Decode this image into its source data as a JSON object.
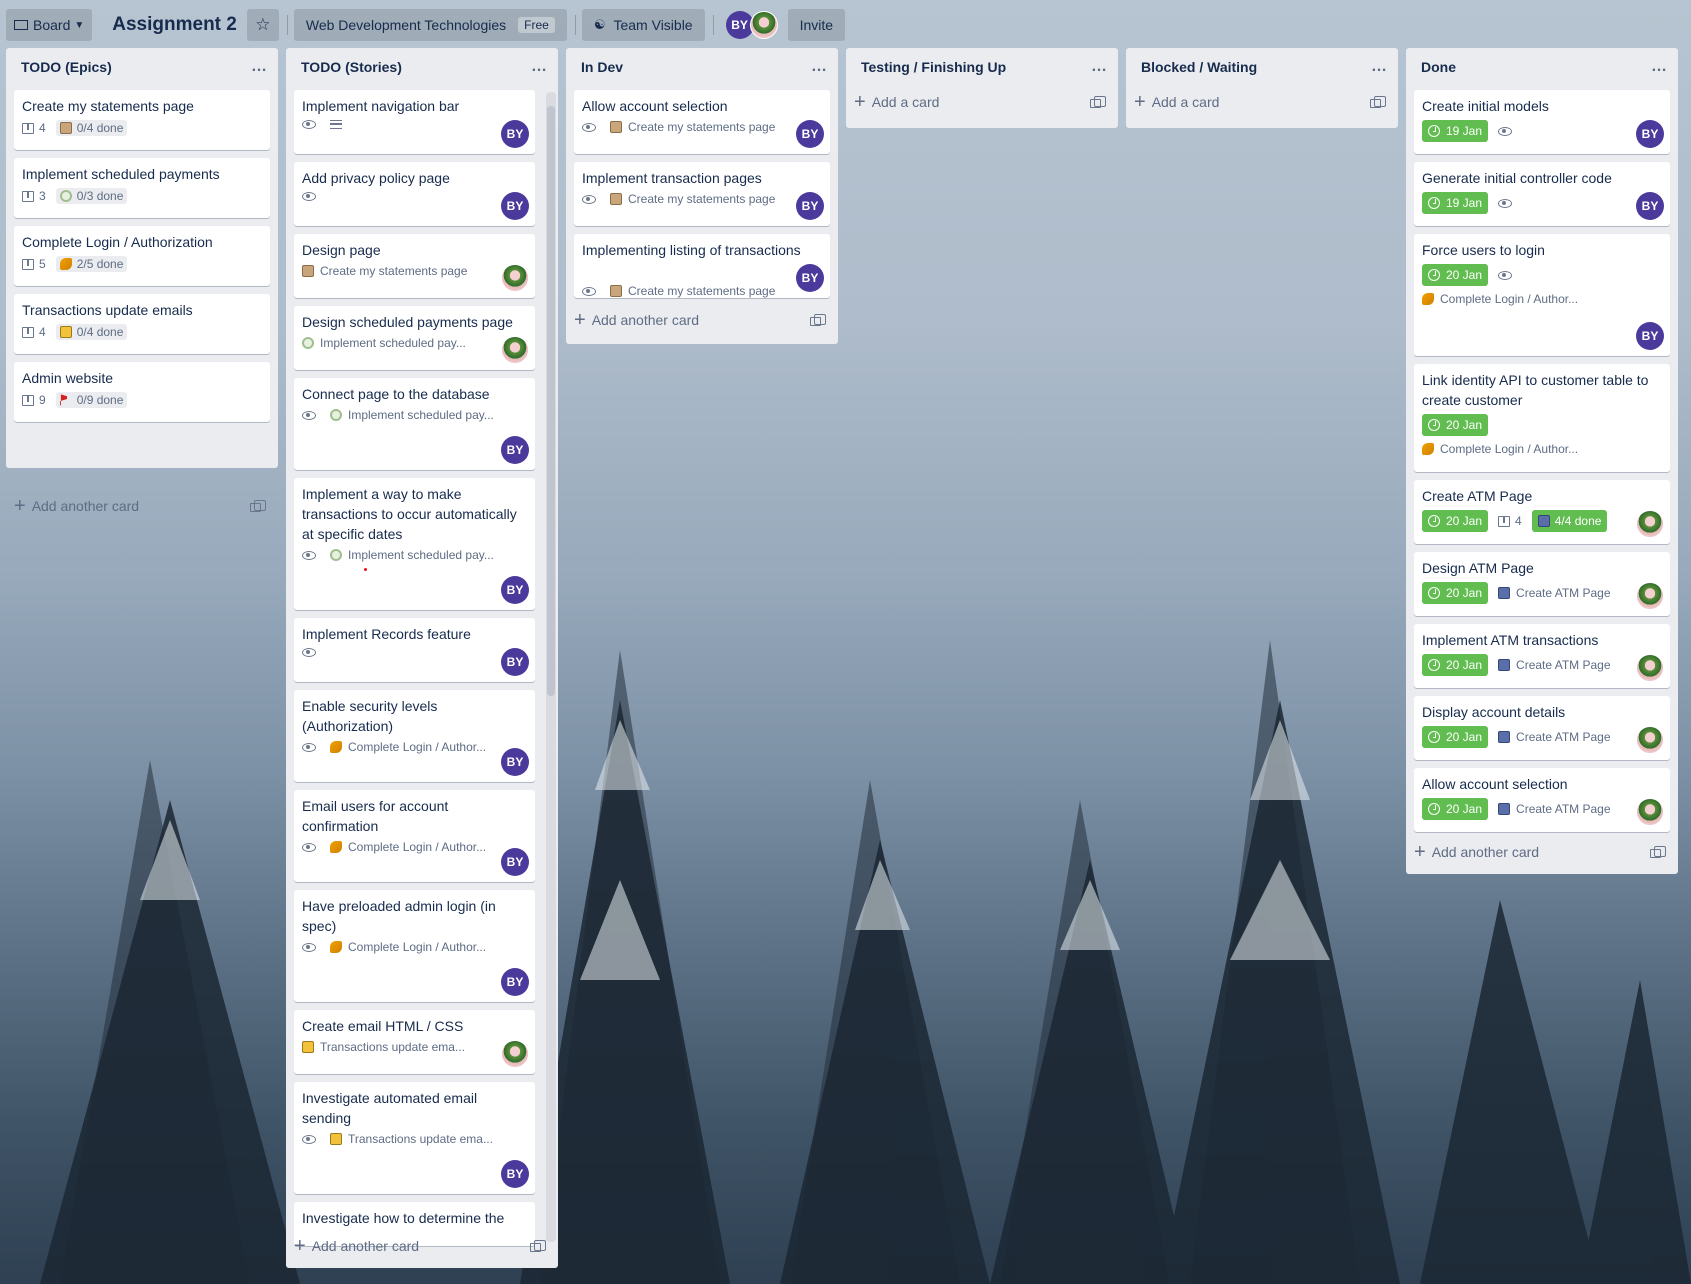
{
  "header": {
    "board_btn": "Board",
    "title": "Assignment 2",
    "team": "Web Development Technologies",
    "team_plan": "Free",
    "visibility": "Team Visible",
    "member_initials": "BY",
    "invite": "Invite"
  },
  "icons": {
    "board": "board-icon",
    "star": "star-icon",
    "eye": "eye-icon",
    "description": "description-icon",
    "due": "clock-icon",
    "more": "more-icon",
    "plus": "plus-icon",
    "template": "template-icon"
  },
  "colors": {
    "due_complete": "#61bd4f",
    "avatar": "#4b3a9c",
    "list_bg": "#ebecf0"
  },
  "lists": [
    {
      "title": "TODO (Epics)",
      "add": "Add another card",
      "cards": [
        {
          "title": "Create my statements page",
          "count": "4",
          "checklist": "0/4 done"
        },
        {
          "title": "Implement scheduled payments",
          "count": "3",
          "checklist": "0/3 done"
        },
        {
          "title": "Complete Login / Authorization",
          "count": "5",
          "checklist": "2/5 done"
        },
        {
          "title": "Transactions update emails",
          "count": "4",
          "checklist": "0/4 done"
        },
        {
          "title": "Admin website",
          "count": "9",
          "checklist": "0/9 done"
        }
      ]
    },
    {
      "title": "TODO (Stories)",
      "add": "Add another card",
      "cards": [
        {
          "title": "Implement navigation bar"
        },
        {
          "title": "Add privacy policy page"
        },
        {
          "title": "Design page",
          "epic": "Create my statements page"
        },
        {
          "title": "Design scheduled payments page",
          "epic": "Implement scheduled pay..."
        },
        {
          "title": "Connect page to the database",
          "epic": "Implement scheduled pay..."
        },
        {
          "title": "Implement a way to make transactions to occur automatically at specific dates",
          "epic": "Implement scheduled pay..."
        },
        {
          "title": "Implement Records feature"
        },
        {
          "title": "Enable security levels (Authorization)",
          "epic": "Complete Login / Author..."
        },
        {
          "title": "Email users for account confirmation",
          "epic": "Complete Login / Author..."
        },
        {
          "title": "Have preloaded admin login (in spec)",
          "epic": "Complete Login / Author..."
        },
        {
          "title": "Create email HTML / CSS",
          "epic": "Transactions update ema..."
        },
        {
          "title": "Investigate automated email sending",
          "epic": "Transactions update ema..."
        },
        {
          "title": "Investigate how to determine the"
        }
      ]
    },
    {
      "title": "In Dev",
      "add": "Add another card",
      "cards": [
        {
          "title": "Allow account selection",
          "epic": "Create my statements page"
        },
        {
          "title": "Implement transaction pages",
          "epic": "Create my statements page"
        },
        {
          "title": "Implementing listing of transactions",
          "epic": "Create my statements page"
        }
      ]
    },
    {
      "title": "Testing / Finishing Up",
      "add": "Add a card",
      "cards": []
    },
    {
      "title": "Blocked / Waiting",
      "add": "Add a card",
      "cards": []
    },
    {
      "title": "Done",
      "add": "Add another card",
      "cards": [
        {
          "title": "Create initial models",
          "due": "19 Jan"
        },
        {
          "title": "Generate initial controller code",
          "due": "19 Jan"
        },
        {
          "title": "Force users to login",
          "due": "20 Jan",
          "epic": "Complete Login / Author..."
        },
        {
          "title": "Link identity API to customer table to create customer",
          "due": "20 Jan",
          "epic": "Complete Login / Author..."
        },
        {
          "title": "Create ATM Page",
          "due": "20 Jan",
          "count": "4",
          "checklist": "4/4 done"
        },
        {
          "title": "Design ATM Page",
          "due": "20 Jan",
          "epic": "Create ATM Page"
        },
        {
          "title": "Implement ATM transactions",
          "due": "20 Jan",
          "epic": "Create ATM Page"
        },
        {
          "title": "Display account details",
          "due": "20 Jan",
          "epic": "Create ATM Page"
        },
        {
          "title": "Allow account selection",
          "due": "20 Jan",
          "epic": "Create ATM Page"
        }
      ]
    }
  ]
}
